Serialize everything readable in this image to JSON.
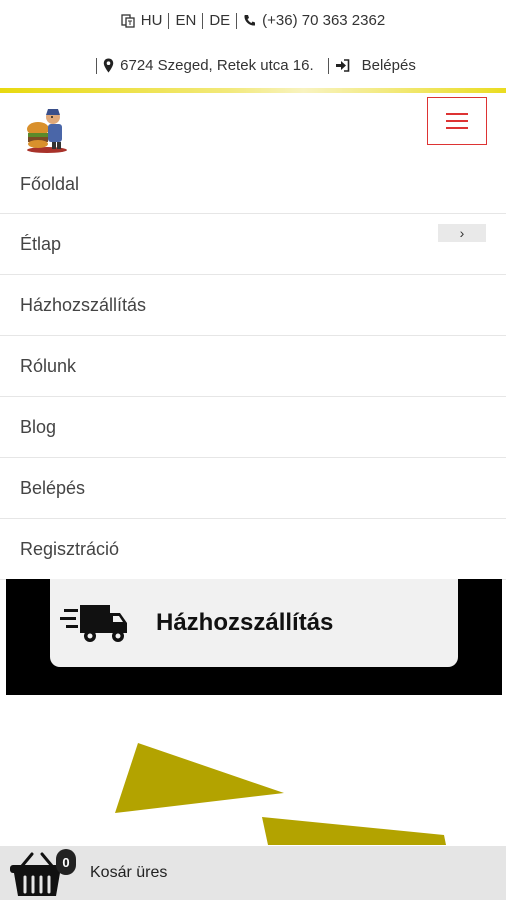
{
  "topbar": {
    "languages": [
      "HU",
      "EN",
      "DE"
    ],
    "phone": "(+36) 70 363 2362",
    "address": "6724 Szeged, Retek utca 16.",
    "login": "Belépés"
  },
  "menu": {
    "items": [
      {
        "label": "Főoldal"
      },
      {
        "label": "Étlap",
        "submenu_toggle": "›"
      },
      {
        "label": "Házhozszállítás"
      },
      {
        "label": "Rólunk"
      },
      {
        "label": "Blog"
      },
      {
        "label": "Belépés"
      },
      {
        "label": "Regisztráció"
      }
    ]
  },
  "delivery": {
    "label": "Házhozszállítás"
  },
  "cart": {
    "count": "0",
    "label": "Kosár üres"
  },
  "colors": {
    "accent_yellow": "#e8d90f",
    "menu_red": "#d33333",
    "deco_olive": "#b3a300"
  },
  "icons": [
    "translate-icon",
    "phone-icon",
    "map-marker-icon",
    "sign-in-icon",
    "hamburger-icon",
    "chevron-right-icon",
    "truck-icon",
    "basket-icon"
  ]
}
